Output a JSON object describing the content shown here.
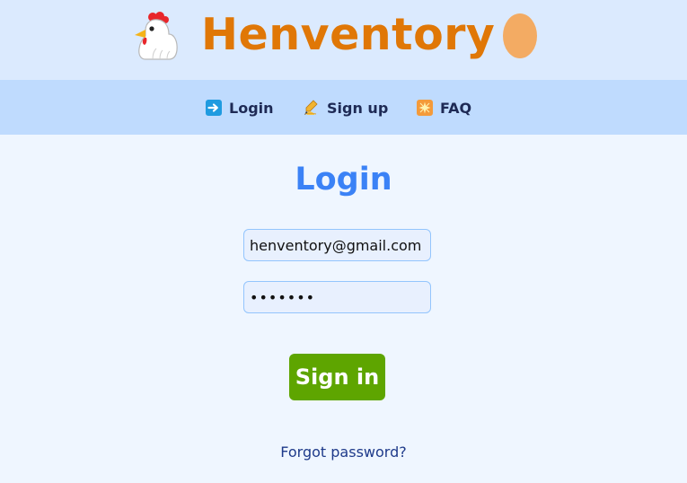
{
  "header": {
    "brand": "Henventory",
    "left_icon": "chicken-icon",
    "right_icon": "egg-icon",
    "brand_color": "#e07706"
  },
  "nav": {
    "items": [
      {
        "label": "Login",
        "icon": "right-arrow-icon"
      },
      {
        "label": "Sign up",
        "icon": "writing-hand-icon"
      },
      {
        "label": "FAQ",
        "icon": "sparkle-icon"
      }
    ]
  },
  "main": {
    "heading": "Login",
    "email": {
      "value": "henventory@gmail.com"
    },
    "password": {
      "value": "•••••••"
    },
    "signin_label": "Sign in",
    "forgot_label": "Forgot password?"
  },
  "colors": {
    "header_bg": "#dbeafe",
    "nav_bg": "#bfdbfe",
    "page_bg": "#eff6ff",
    "heading": "#3b82f6",
    "button": "#5ea500"
  }
}
